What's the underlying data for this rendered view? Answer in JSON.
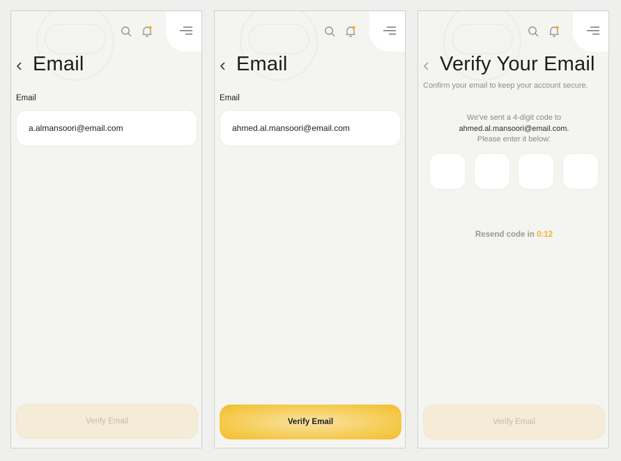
{
  "screens": [
    {
      "title": "Email",
      "field_label": "Email",
      "email_value": "a.almansoori@email.com",
      "button_label": "Verify Email",
      "button_state": "disabled"
    },
    {
      "title": "Email",
      "field_label": "Email",
      "email_value": "ahmed.al.mansoori@email.com",
      "button_label": "Verify Email",
      "button_state": "enabled"
    },
    {
      "title": "Verify Your Email",
      "subtitle": "Confirm your email to keep your account secure.",
      "code_line1": "We've sent a 4-digit code to",
      "code_email": "ahmed.al.mansoori@email.com.",
      "code_line3": "Please enter it below:",
      "code_digits": [
        "",
        "",
        "",
        ""
      ],
      "resend_label": "Resend code in",
      "resend_timer": "0:12",
      "button_label": "Verify Email",
      "button_state": "disabled"
    }
  ],
  "icons": {
    "search": "search-icon",
    "notifications": "bell-icon",
    "menu": "menu-icon",
    "back": "chevron-left-icon"
  },
  "colors": {
    "accent": "#f5c94a",
    "notification_dot": "#f0b428",
    "background": "#f4f4f0"
  }
}
